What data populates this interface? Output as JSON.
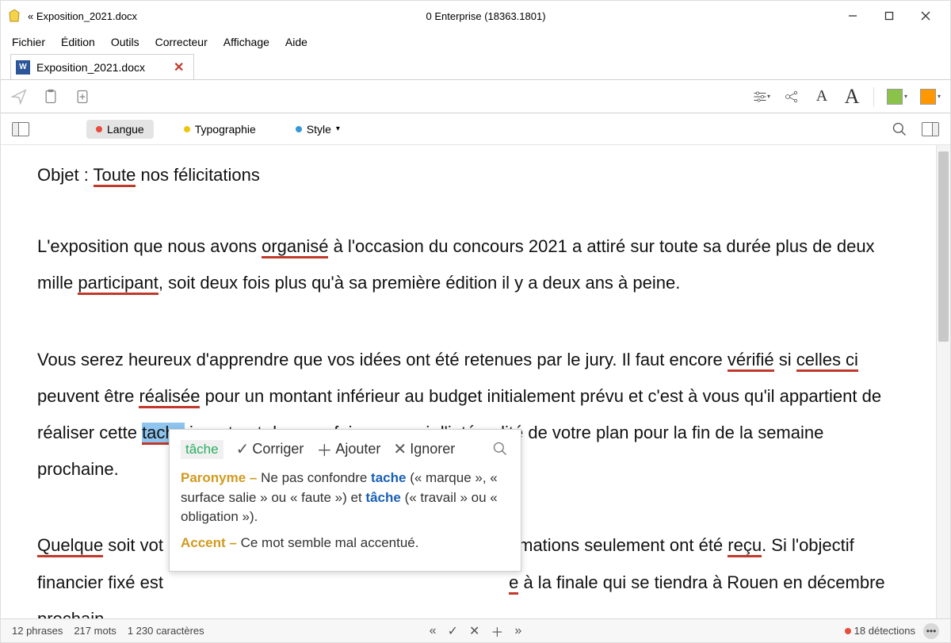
{
  "titlebar": {
    "doc_title": "« Exposition_2021.docx",
    "center": "0 Enterprise (18363.1801)"
  },
  "menu": {
    "fichier": "Fichier",
    "edition": "Édition",
    "outils": "Outils",
    "correcteur": "Correcteur",
    "affichage": "Affichage",
    "aide": "Aide"
  },
  "tab": {
    "label": "Exposition_2021.docx"
  },
  "filters": {
    "langue": "Langue",
    "typographie": "Typographie",
    "style": "Style"
  },
  "document": {
    "line1_prefix": "Objet : ",
    "line1_err": "Toute",
    "line1_suffix": " nos félicitations",
    "p2_a": "L'exposition que nous avons ",
    "p2_err1": "organisé",
    "p2_b": " à l'occasion du concours 2021 a attiré sur toute sa durée plus de deux mille ",
    "p2_err2": "participant",
    "p2_c": ", soit deux fois plus qu'à sa première édition il y a deux ans à peine.",
    "p3_a": "Vous serez heureux d'apprendre que vos idées ont été  retenues par le jury. Il faut encore ",
    "p3_err1": "vérifié",
    "p3_b": " si ",
    "p3_err2": "celles ci",
    "p3_c": " peuvent être ",
    "p3_err3": "réalisée",
    "p3_d": " pour un montant  inférieur au budget initialement prévu et c'est à vous qu'il appartient de réaliser cette ",
    "p3_sel": "tache",
    "p3_e": " ingrate et de nous faire parvenir l'intégralité de votre plan pour la fin de la semaine prochaine.",
    "p4_err1": "Quelque",
    "p4_a": " soit vot",
    "p4_gap": "stimations seulement ont été ",
    "p4_err2": "reçu",
    "p4_b": ". Si l'objectif financier fixé est",
    "p4_c": " à la finale qui se tiendra à Rouen en décembre prochain."
  },
  "popup": {
    "suggestion": "tâche",
    "corriger": "Corriger",
    "ajouter": "Ajouter",
    "ignorer": "Ignorer",
    "paronyme_label": "Paronyme –",
    "paronyme_text_a": " Ne pas confondre ",
    "paronyme_kw1": "tache",
    "paronyme_text_b": " (« marque », « surface salie » ou « faute ») et ",
    "paronyme_kw2": "tâche",
    "paronyme_text_c": " (« travail » ou « obligation »).",
    "accent_label": "Accent –",
    "accent_text": " Ce mot semble mal accentué."
  },
  "status": {
    "phrases": "12 phrases",
    "mots": "217 mots",
    "chars": "1 230 caractères",
    "detections": "18 détections"
  },
  "colors": {
    "error_underline": "#c0392b",
    "selection": "#8fc5ef",
    "suggestion": "#27ae60",
    "paronyme_label": "#d19a1f",
    "keyword": "#1a5fb4"
  }
}
